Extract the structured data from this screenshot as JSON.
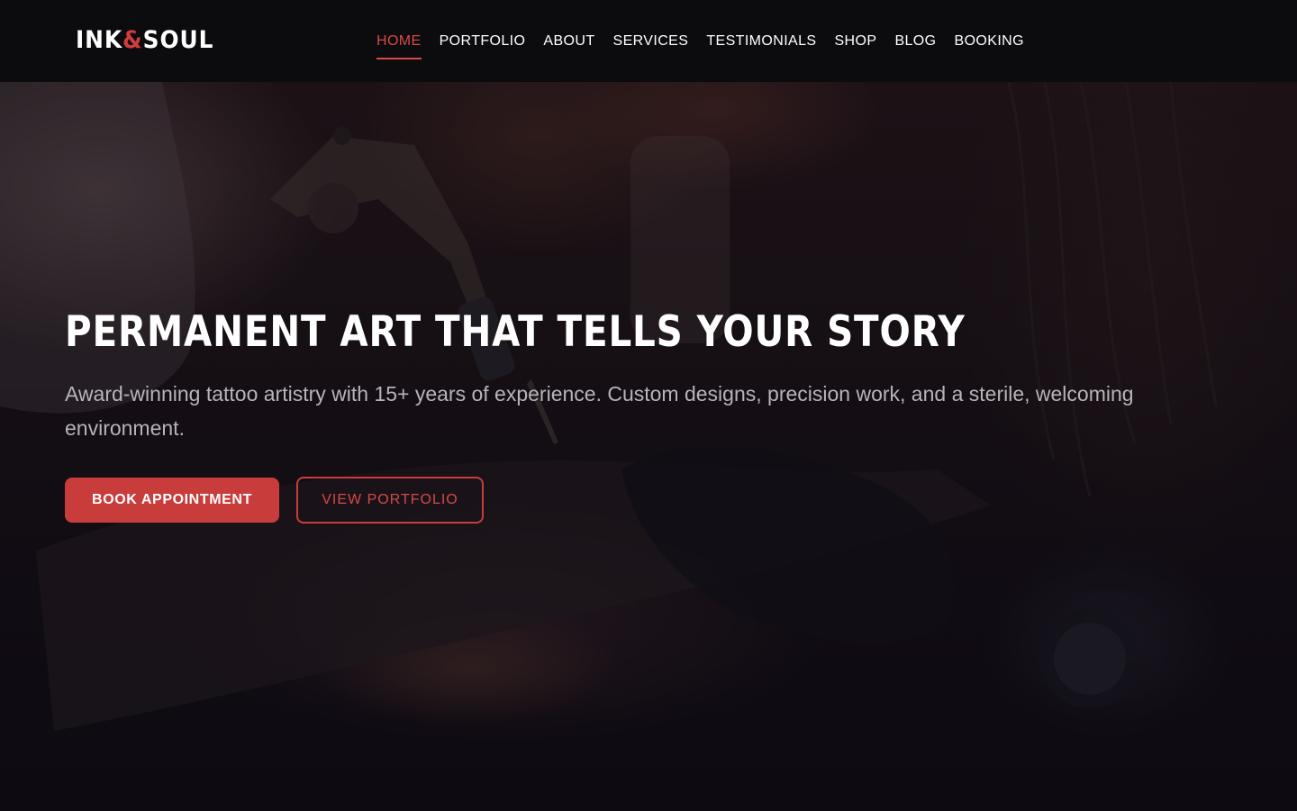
{
  "brand": {
    "logo_left": "INK",
    "logo_amp": "&",
    "logo_right": "SOUL",
    "accent_color": "#d13c3c"
  },
  "nav": {
    "items": [
      {
        "label": "HOME",
        "active": true
      },
      {
        "label": "PORTFOLIO",
        "active": false
      },
      {
        "label": "ABOUT",
        "active": false
      },
      {
        "label": "SERVICES",
        "active": false
      },
      {
        "label": "TESTIMONIALS",
        "active": false
      },
      {
        "label": "SHOP",
        "active": false
      },
      {
        "label": "BLOG",
        "active": false
      },
      {
        "label": "BOOKING",
        "active": false
      }
    ]
  },
  "hero": {
    "title": "PERMANENT ART THAT TELLS YOUR STORY",
    "subtitle": "Award-winning tattoo artistry with 15+ years of experience. Custom designs, precision work, and a sterile, welcoming environment.",
    "primary_button": "BOOK APPOINTMENT",
    "secondary_button": "VIEW PORTFOLIO"
  }
}
